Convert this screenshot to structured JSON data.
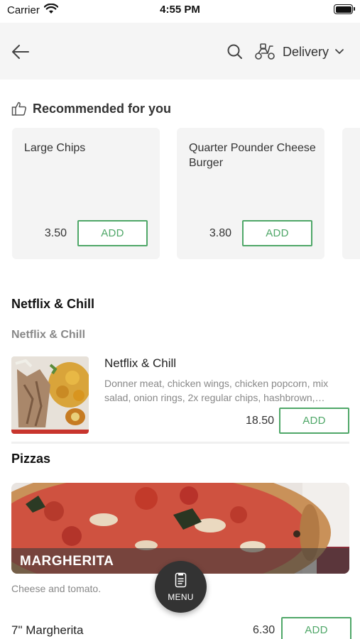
{
  "status_bar": {
    "carrier": "Carrier",
    "time": "4:55 PM"
  },
  "nav": {
    "delivery_label": "Delivery"
  },
  "recommended": {
    "title": "Recommended for you",
    "items": [
      {
        "name": "Large Chips",
        "price": "3.50",
        "add_label": "ADD"
      },
      {
        "name": "Quarter Pounder Cheese Burger",
        "price": "3.80",
        "add_label": "ADD"
      }
    ]
  },
  "sections": [
    {
      "title": "Netflix & Chill",
      "subtitle": "Netflix & Chill",
      "item": {
        "name": "Netflix & Chill",
        "description": "Donner meat, chicken wings, chicken popcorn, mix salad, onion rings, 2x regular chips, hashbrown,…",
        "price": "18.50",
        "add_label": "ADD"
      }
    },
    {
      "title": "Pizzas",
      "banner_label": "MARGHERITA",
      "banner_description": "Cheese and tomato.",
      "item": {
        "name": "7\" Margherita",
        "price": "6.30",
        "add_label": "ADD"
      }
    }
  ],
  "menu_button": {
    "label": "MENU"
  },
  "colors": {
    "accent_green": "#4fa768",
    "nav_background": "#f5f5f5",
    "card_background": "#f4f4f4",
    "fab_background": "#333333"
  },
  "icons": [
    "wifi-icon",
    "battery-icon",
    "back-arrow-icon",
    "search-icon",
    "scooter-icon",
    "chevron-down-icon",
    "thumbs-up-icon",
    "menu-book-icon"
  ]
}
